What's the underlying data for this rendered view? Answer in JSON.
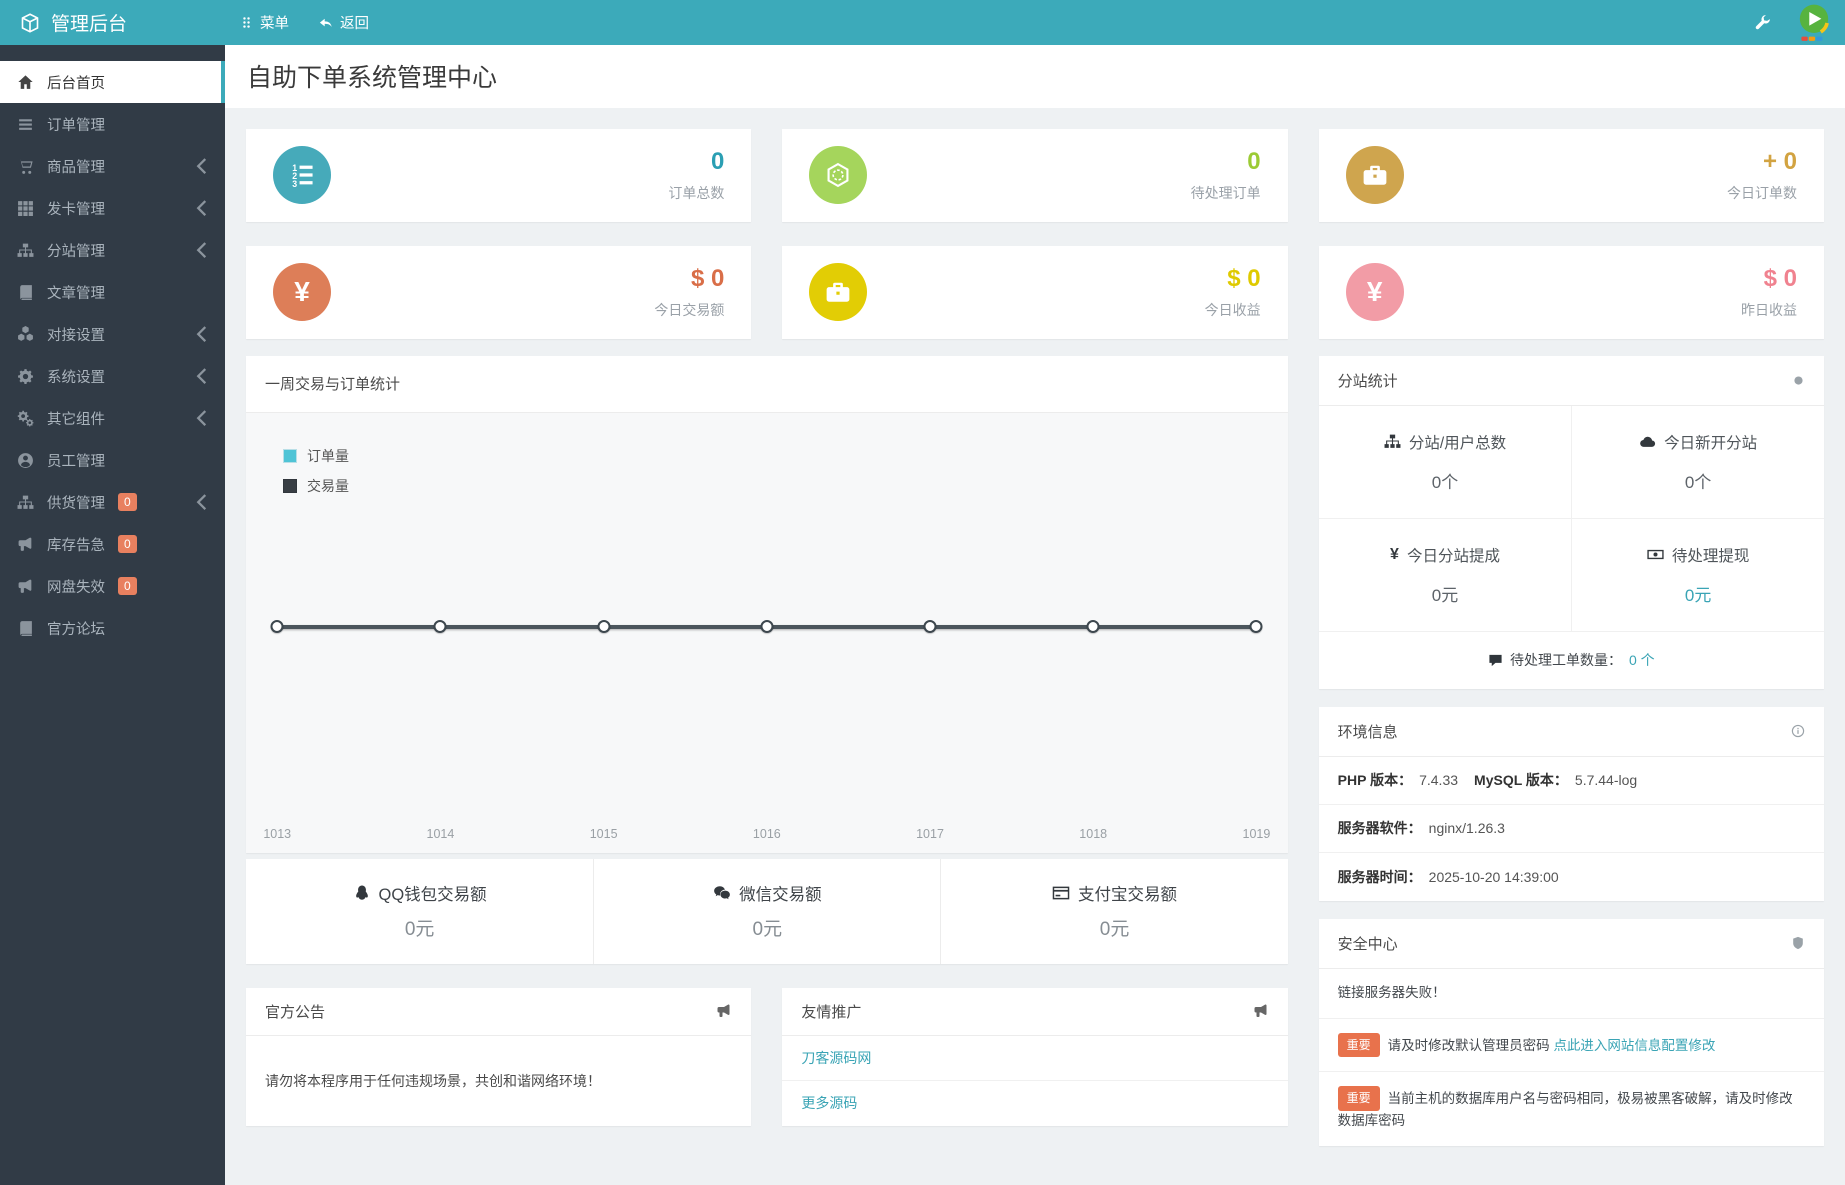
{
  "colors": {
    "accent": "#3caaba",
    "sidebar-bg": "#313b46",
    "badge": "#e8805f",
    "content-bg": "#eef1f3",
    "link": "#3aa4b5",
    "warn": "#e8724c"
  },
  "topbar": {
    "brand": "管理后台",
    "menu_label": "菜单",
    "back_label": "返回"
  },
  "sidebar": {
    "items": [
      {
        "label": "后台首页"
      },
      {
        "label": "订单管理"
      },
      {
        "label": "商品管理"
      },
      {
        "label": "发卡管理"
      },
      {
        "label": "分站管理"
      },
      {
        "label": "文章管理"
      },
      {
        "label": "对接设置"
      },
      {
        "label": "系统设置"
      },
      {
        "label": "其它组件"
      },
      {
        "label": "员工管理"
      },
      {
        "label": "供货管理",
        "badge": "0"
      },
      {
        "label": "库存告急",
        "badge": "0"
      },
      {
        "label": "网盘失效",
        "badge": "0"
      },
      {
        "label": "官方论坛"
      }
    ]
  },
  "page": {
    "title": "自助下单系统管理中心"
  },
  "stat_cards": [
    {
      "value": "0",
      "label": "订单总数",
      "circle": "#46aaba",
      "color": "#2b9fb3"
    },
    {
      "value": "0",
      "label": "待处理订单",
      "circle": "#a5d55c",
      "color": "#9ccb35"
    },
    {
      "value": "+ 0",
      "label": "今日订单数",
      "circle": "#cfa54e",
      "color": "#d2a341"
    },
    {
      "value": "$ 0",
      "label": "今日交易额",
      "circle": "#dd7e58",
      "color": "#d96e48"
    },
    {
      "value": "$ 0",
      "label": "今日收益",
      "circle": "#e2cd05",
      "color": "#dfca00"
    },
    {
      "value": "$ 0",
      "label": "昨日收益",
      "circle": "#f29ca6",
      "color": "#f0828f"
    }
  ],
  "chart_panel": {
    "title": "一周交易与订单统计",
    "chart_data": {
      "type": "line",
      "x": [
        "1013",
        "1014",
        "1015",
        "1016",
        "1017",
        "1018",
        "1019"
      ],
      "series": [
        {
          "name": "订单量",
          "values": [
            0,
            0,
            0,
            0,
            0,
            0,
            0
          ],
          "color": "#4fc4d6"
        },
        {
          "name": "交易量",
          "values": [
            0,
            0,
            0,
            0,
            0,
            0,
            0
          ],
          "color": "#383e44"
        }
      ],
      "line_color": "#4b555c",
      "ylim": [
        0,
        0
      ],
      "grid": false,
      "legend_position": "top-left"
    }
  },
  "pay_stats": [
    {
      "label": "QQ钱包交易额",
      "value": "0元"
    },
    {
      "label": "微信交易额",
      "value": "0元"
    },
    {
      "label": "支付宝交易额",
      "value": "0元"
    }
  ],
  "notice": {
    "title": "官方公告",
    "body": "请勿将本程序用于任何违规场景，共创和谐网络环境！"
  },
  "promo": {
    "title": "友情推广",
    "links": [
      "刀客源码网",
      "更多源码"
    ]
  },
  "substation": {
    "title": "分站统计",
    "cells": [
      {
        "label": "分站/用户总数",
        "value": "0个"
      },
      {
        "label": "今日新开分站",
        "value": "0个"
      },
      {
        "label": "今日分站提成",
        "value": "0元"
      },
      {
        "label": "待处理提现",
        "value": "0元",
        "value_color": "#3aa4b5"
      }
    ],
    "footer_label": "待处理工单数量：",
    "footer_value": "0 个"
  },
  "environment": {
    "title": "环境信息",
    "rows": [
      {
        "pairs": [
          {
            "label": "PHP 版本：",
            "value": "7.4.33"
          },
          {
            "label": "MySQL 版本：",
            "value": "5.7.44-log"
          }
        ]
      },
      {
        "pairs": [
          {
            "label": "服务器软件：",
            "value": "nginx/1.26.3"
          }
        ]
      },
      {
        "pairs": [
          {
            "label": "服务器时间：",
            "value": "2025-10-20 14:39:00"
          }
        ]
      }
    ]
  },
  "security": {
    "title": "安全中心",
    "alert": "链接服务器失败！",
    "warnings": [
      {
        "badge": "重要",
        "text": "请及时修改默认管理员密码 ",
        "link": "点此进入网站信息配置修改"
      },
      {
        "badge": "重要",
        "text": "当前主机的数据库用户名与密码相同，极易被黑客破解，请及时修改数据库密码"
      }
    ]
  }
}
